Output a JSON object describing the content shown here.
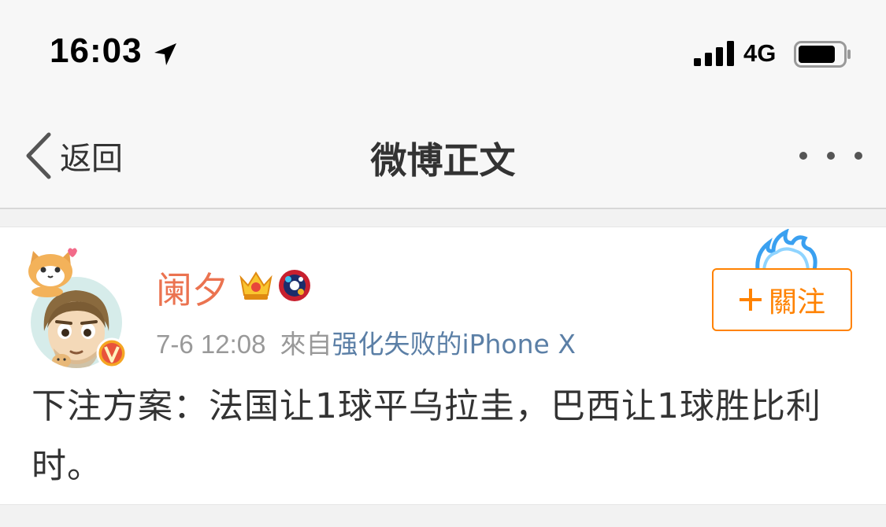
{
  "status_bar": {
    "time": "16:03",
    "network": "4G",
    "icons": [
      "location-arrow-icon",
      "cellular-signal-icon",
      "battery-icon"
    ]
  },
  "nav": {
    "back_label": "返回",
    "title": "微博正文",
    "more_icon": "more-icon"
  },
  "post": {
    "username": "阑夕",
    "badges": [
      "crown-badge-icon",
      "worldcup-badge-icon"
    ],
    "time": "7-6 12:08",
    "from_label": "來自",
    "device": "强化失败的iPhone X",
    "follow_label": "關注",
    "content": "下注方案：法国让1球平乌拉圭，巴西让1球胜比利时。"
  },
  "colors": {
    "username": "#eb7350",
    "follow_accent": "#ff8200",
    "link": "#5b7fa6",
    "meta": "#999999",
    "text": "#333333"
  }
}
